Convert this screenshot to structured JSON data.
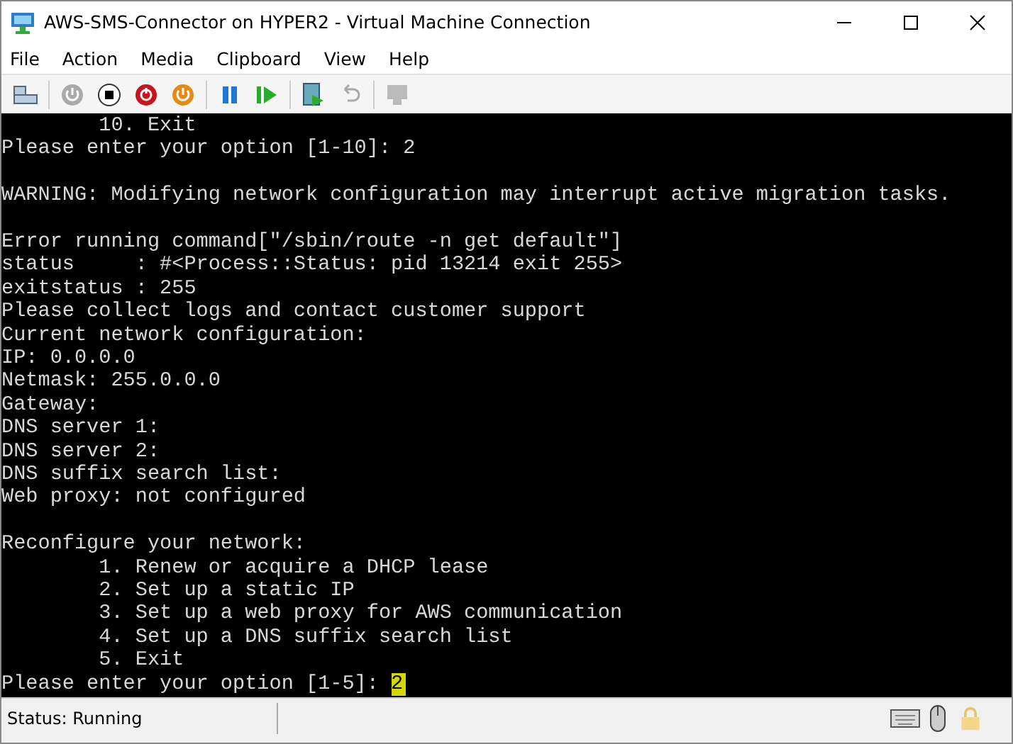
{
  "window": {
    "title": "AWS-SMS-Connector on HYPER2 - Virtual Machine Connection"
  },
  "menu": [
    "File",
    "Action",
    "Media",
    "Clipboard",
    "View",
    "Help"
  ],
  "toolbar": [
    {
      "kind": "ctrl-alt-del",
      "disabled": false
    },
    {
      "kind": "sep"
    },
    {
      "kind": "start",
      "disabled": true
    },
    {
      "kind": "turn-off",
      "disabled": false
    },
    {
      "kind": "shut-down",
      "disabled": false
    },
    {
      "kind": "save",
      "disabled": false
    },
    {
      "kind": "sep"
    },
    {
      "kind": "pause",
      "disabled": false
    },
    {
      "kind": "reset",
      "disabled": false
    },
    {
      "kind": "sep"
    },
    {
      "kind": "checkpoint",
      "disabled": false
    },
    {
      "kind": "revert",
      "disabled": true
    },
    {
      "kind": "sep"
    },
    {
      "kind": "enhanced-session",
      "disabled": true
    }
  ],
  "console": {
    "blocks": [
      [
        "        10. Exit",
        "Please enter your option [1-10]: 2"
      ],
      [
        "WARNING: Modifying network configuration may interrupt active migration tasks."
      ],
      [
        "Error running command[\"/sbin/route -n get default\"]",
        "status     : #<Process::Status: pid 13214 exit 255>",
        "exitstatus : 255",
        "Please collect logs and contact customer support",
        "Current network configuration:",
        "IP: 0.0.0.0",
        "Netmask: 255.0.0.0",
        "Gateway:",
        "DNS server 1:",
        "DNS server 2:",
        "DNS suffix search list:",
        "Web proxy: not configured"
      ],
      [
        "Reconfigure your network:",
        "        1. Renew or acquire a DHCP lease",
        "        2. Set up a static IP",
        "        3. Set up a web proxy for AWS communication",
        "        4. Set up a DNS suffix search list",
        "        5. Exit"
      ]
    ],
    "prompt": "Please enter your option [1-5]: ",
    "input": "2"
  },
  "status_bar": {
    "status": "Status: Running"
  }
}
